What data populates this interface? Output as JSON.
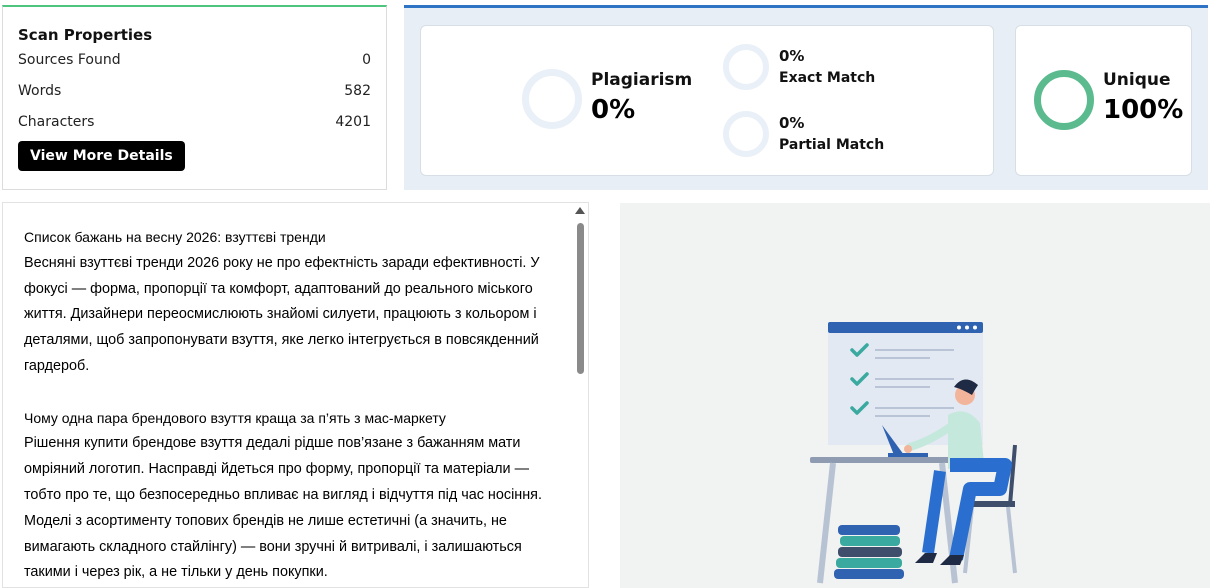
{
  "scan_properties": {
    "title": "Scan Properties",
    "rows": [
      {
        "label": "Sources Found",
        "value": "0"
      },
      {
        "label": "Words",
        "value": "582"
      },
      {
        "label": "Characters",
        "value": "4201"
      }
    ],
    "details_button": "View More Details"
  },
  "results": {
    "plagiarism_label": "Plagiarism",
    "plagiarism_value": "0%",
    "exact_value": "0%",
    "exact_label": "Exact Match",
    "partial_value": "0%",
    "partial_label": "Partial Match",
    "unique_label": "Unique",
    "unique_value": "100%",
    "unique_fraction": 1.0,
    "colors": {
      "accent_top": "#2f73c4",
      "unique_ring": "#5cba8f",
      "empty_ring": "#eaf0f8",
      "scan_border": "#4ec47e"
    }
  },
  "text_content": {
    "paragraph1": [
      "Список бажань на весну 2026: взуттєві тренди",
      "Весняні взуттєві тренди 2026 року не про ефектність заради ефективності. У",
      "фокусі — форма, пропорції та комфорт, адаптований до реального міського",
      "життя. Дизайнери переосмислюють знайомі силуети, працюють з кольором і",
      "деталями, щоб запропонувати взуття, яке легко інтегрується в повсякденний",
      "гардероб."
    ],
    "paragraph2": [
      "Чому одна пара брендового взуття краща за п’ять з мас-маркету",
      "Рішення купити брендове взуття дедалі рідше пов’язане з бажанням мати",
      "омріяний логотип. Насправді йдеться про форму, пропорції та матеріали —",
      "тобто про те, що безпосередньо впливає на вигляд і відчуття під час носіння.",
      "Моделі з асортименту топових брендів не лише естетичні (а значить, не",
      "вимагають складного стайлінгу) — вони зручні й витривалі, і залишаються",
      "такими і через рік, а не тільки у день покупки."
    ]
  }
}
